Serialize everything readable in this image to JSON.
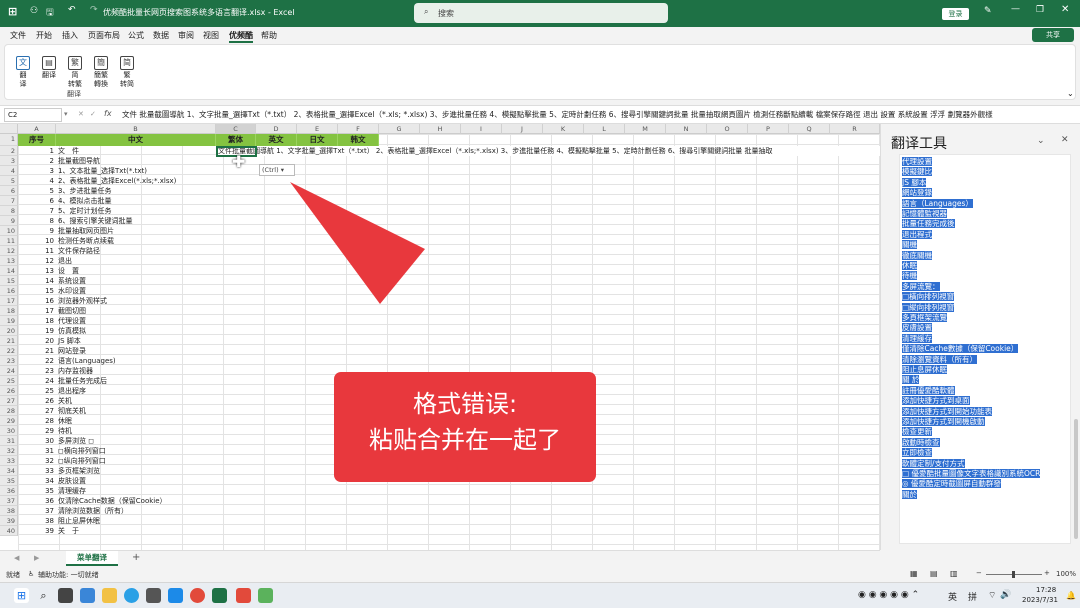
{
  "window": {
    "title": "优频酷批量长网页搜索图系统多语言翻译.xlsx - Excel",
    "search_placeholder": "搜索",
    "login": "登录"
  },
  "menu": [
    "文件",
    "开始",
    "插入",
    "页面布局",
    "公式",
    "数据",
    "审阅",
    "视图",
    "优频酷",
    "帮助"
  ],
  "share": "共享",
  "ribbon": {
    "buttons": [
      {
        "label": "翻\n译",
        "icon": "translate-icon"
      },
      {
        "label": "翻译",
        "icon": "document-icon"
      },
      {
        "label": "简\n转繁",
        "icon": "simp-to-trad-icon"
      },
      {
        "label": "簡繁\n轉換",
        "icon": "convert-icon"
      },
      {
        "label": "繁\n转简",
        "icon": "trad-to-simp-icon"
      }
    ],
    "group_label": "翻译"
  },
  "formula_bar": {
    "name_box": "C2",
    "fx": "fx",
    "content": "文件 批量截圖導航 1、文字批量_選擇Txt（*.txt） 2、表格批量_選擇Excel（*.xls; *.xlsx) 3、步進批量任務 4、模擬點擊批量 5、定時計劃任務 6、搜尋引擎關鍵詞批量 批量抽取網頁圖片 檢測任務斷點續載 檔案保存路徑 退出 設置 系統設置 浮浮 劃覽器外觀樣"
  },
  "columns": [
    "A",
    "B",
    "C",
    "D",
    "E",
    "F",
    "G",
    "H",
    "I",
    "J",
    "K",
    "L",
    "M",
    "N",
    "O",
    "P",
    "Q",
    "R"
  ],
  "header_row": [
    "序号",
    "中文",
    "繁体",
    "英文",
    "日文",
    "韩文"
  ],
  "row2_overflow": "文件批量截圖導航 1、文字批量_選擇Txt（*.txt） 2、表格批量_選擇Excel（*.xls;*.xlsx) 3、步進批量任務 4、模擬點擊批量 5、定時計劃任務 6、搜尋引擎關鍵詞批量 批量抽取",
  "paste_options": "(Ctrl) ▾",
  "rows": [
    {
      "n": "1",
      "zh": "文　件"
    },
    {
      "n": "2",
      "zh": "批量截图导航"
    },
    {
      "n": "3",
      "zh": "1、文本批量_选择Txt(*.txt)"
    },
    {
      "n": "4",
      "zh": "2、表格批量_选择Excel(*.xls;*.xlsx)"
    },
    {
      "n": "5",
      "zh": "3、步进批量任务"
    },
    {
      "n": "6",
      "zh": "4、模拟点击批量"
    },
    {
      "n": "7",
      "zh": "5、定时计划任务"
    },
    {
      "n": "8",
      "zh": "6、搜索引擎关键词批量"
    },
    {
      "n": "9",
      "zh": "批量抽取网页图片"
    },
    {
      "n": "10",
      "zh": "检测任务断点续载"
    },
    {
      "n": "11",
      "zh": "文件保存路径"
    },
    {
      "n": "12",
      "zh": "退出"
    },
    {
      "n": "13",
      "zh": "设　置"
    },
    {
      "n": "14",
      "zh": "系统设置"
    },
    {
      "n": "15",
      "zh": "水印设置"
    },
    {
      "n": "16",
      "zh": "浏览器外观样式"
    },
    {
      "n": "17",
      "zh": "截图切图"
    },
    {
      "n": "18",
      "zh": "代理设置"
    },
    {
      "n": "19",
      "zh": "仿真模拟"
    },
    {
      "n": "20",
      "zh": "JS 脚本"
    },
    {
      "n": "21",
      "zh": "网站登录"
    },
    {
      "n": "22",
      "zh": "语言(Languages)"
    },
    {
      "n": "23",
      "zh": "内存监视器"
    },
    {
      "n": "24",
      "zh": "批量任务完成后"
    },
    {
      "n": "25",
      "zh": "退出程序"
    },
    {
      "n": "26",
      "zh": "关机"
    },
    {
      "n": "27",
      "zh": "彻底关机"
    },
    {
      "n": "28",
      "zh": "休眠"
    },
    {
      "n": "29",
      "zh": "待机"
    },
    {
      "n": "30",
      "zh": "多屏浏览 ◻"
    },
    {
      "n": "31",
      "zh": "◻横向排列窗口"
    },
    {
      "n": "32",
      "zh": "◻纵向排列窗口"
    },
    {
      "n": "33",
      "zh": "多页框架浏览"
    },
    {
      "n": "34",
      "zh": "皮肤设置"
    },
    {
      "n": "35",
      "zh": "清理缓存"
    },
    {
      "n": "36",
      "zh": "仅清除Cache数据（保留Cookie）"
    },
    {
      "n": "37",
      "zh": "清除浏览数据（所有）"
    },
    {
      "n": "38",
      "zh": "阻止息屏休眠"
    },
    {
      "n": "39",
      "zh": "关　于"
    }
  ],
  "row_numbers": [
    "1",
    "2",
    "3",
    "4",
    "5",
    "6",
    "7",
    "8",
    "9",
    "10",
    "11",
    "12",
    "13",
    "14",
    "15",
    "16",
    "17",
    "18",
    "19",
    "20",
    "21",
    "22",
    "23",
    "24",
    "25",
    "26",
    "27",
    "28",
    "29",
    "30",
    "31",
    "32",
    "33",
    "34",
    "35",
    "36",
    "37",
    "38",
    "39",
    "40"
  ],
  "callout": {
    "line1": "格式错误:",
    "line2": "粘贴合并在一起了",
    "color": "#e8383d"
  },
  "panel": {
    "title": "翻译工具",
    "items": [
      "代理設置",
      "模擬鍵比",
      "JS 腳本",
      "網站登錄",
      "語言（Languages）",
      "記憶體監視器",
      "批量任務完成後",
      "退出程式",
      "關機",
      "徹底關機",
      "休眠",
      "待機",
      "多屏流覽：",
      "□橫向排列視窗",
      "□縱向排列視窗",
      "多頁框架流覽",
      "皮膚設置",
      "清理緩存",
      "僅清除Cache數據（保留Cookie）",
      "清除瀏覽資料（所有）",
      "阻止息屏休眠",
      "關 於",
      "註冊優愛酷軟體",
      "添加快捷方式到桌面",
      "添加快捷方式到開始功能表",
      "添加快捷方式到開機啟動",
      "檢查更新",
      "啟動時檢查",
      "立即檢查",
      "軟體定制/支付方式",
      "□ 優愛酷批量圖像文字表格識別系統OCR",
      "◎ 優愛酷定時截圖屏自動群發",
      "關於"
    ]
  },
  "sheet_tab": "菜单翻译",
  "add_sheet": "+",
  "status": {
    "ready": "就绪",
    "accessibility": "辅助功能: 一切就绪",
    "zoom": "100%"
  },
  "taskbar": {
    "ime1": "英",
    "ime2": "拼",
    "time": "17:28",
    "date": "2023/7/31"
  }
}
